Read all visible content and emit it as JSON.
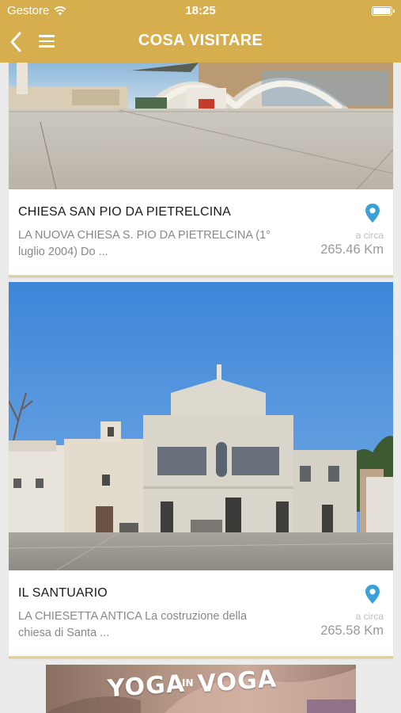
{
  "status_bar": {
    "carrier": "Gestore",
    "time": "18:25"
  },
  "nav": {
    "title": "COSA VISITARE"
  },
  "places": [
    {
      "name": "CHIESA SAN PIO DA PIETRELCINA",
      "description": "LA NUOVA CHIESA S. PIO DA PIETRELCINA (1° luglio 2004) Do ...",
      "distance_prefix": "a circa",
      "distance": "265.46 Km"
    },
    {
      "name": "IL SANTUARIO",
      "description": "LA CHIESETTA ANTICA La costruzione della chiesa di Santa ...",
      "distance_prefix": "a circa",
      "distance": "265.58 Km"
    }
  ],
  "ad_banner": {
    "word1": "YOGA",
    "word_small": "IN",
    "word2": "VOGA"
  },
  "colors": {
    "header": "#d6ae4d",
    "pin": "#3aa0d8",
    "background": "#ebebeb"
  }
}
